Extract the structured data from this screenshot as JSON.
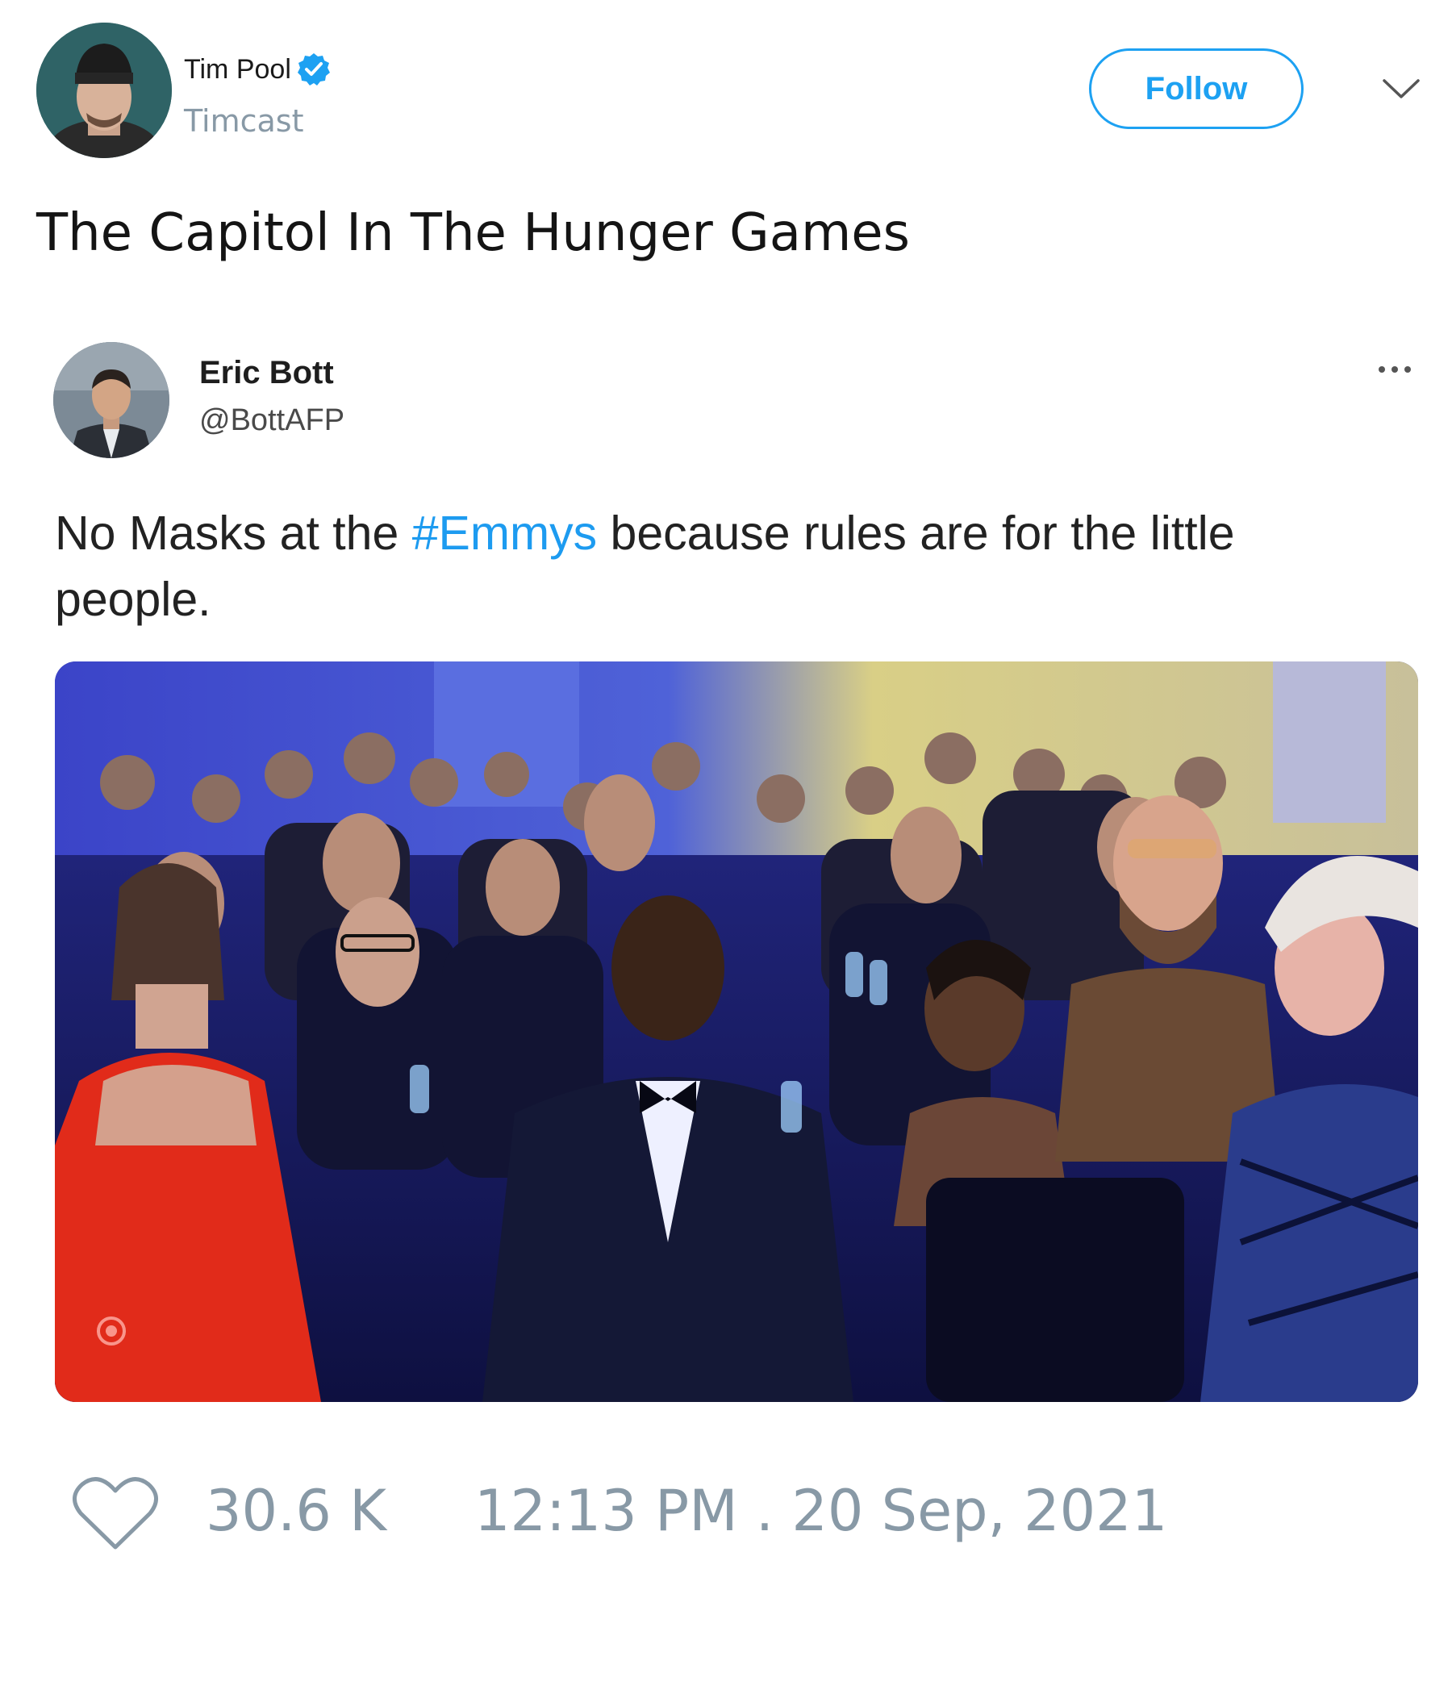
{
  "author": {
    "name": "Tim Pool",
    "handle": "Timcast",
    "verified": true
  },
  "follow_button": {
    "label": "Follow"
  },
  "tweet": {
    "text": "The Capitol In The Hunger Games"
  },
  "quoted_tweet": {
    "name": "Eric Bott",
    "handle": "@BottAFP",
    "more_icon": "more-horizontal-icon",
    "text_before": "No Masks at the ",
    "hashtag": "#Emmys",
    "text_after": " because rules are for the little people."
  },
  "footer": {
    "likes": "30.6 K",
    "timestamp": "12:13 PM . 20 Sep, 2021",
    "like_icon": "heart-icon"
  },
  "colors": {
    "accent": "#1da1f2",
    "muted": "#8899a6",
    "text": "#141414"
  }
}
